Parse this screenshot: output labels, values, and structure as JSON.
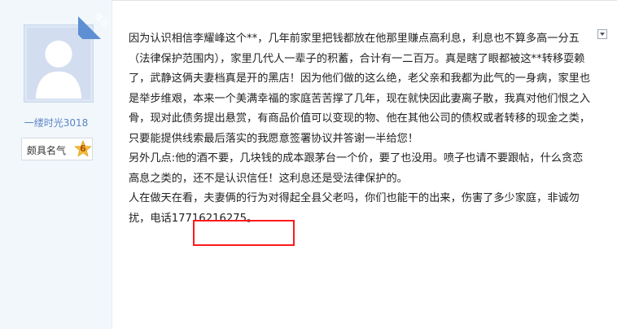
{
  "post": {
    "badge_label": "楼主",
    "author": {
      "username": "一缕时光3018",
      "reputation_label": "颇具名气",
      "reputation_level": "6"
    },
    "paragraphs": [
      "因为认识相信李耀峰这个**，几年前家里把钱都放在他那里赚点高利息，利息也不算多高一分五（法律保护范围内），家里几代人一辈子的积蓄，合计有一二百万。真是瞎了眼都被这**转移耍赖了，武静这俩夫妻档真是开的黑店！因为他们做的这么绝，老父亲和我都为此气的一身病，家里也是举步维艰，本来一个美满幸福的家庭苦苦撑了几年，现在就快因此妻离子散，我真对他们恨之入骨，现对此债务提出悬赏，有商品价值可以变现的物、他在其他公司的债权或者转移的现金之类，只要能提供线索最后落实的我愿意签署协议并答谢一半给您！",
      "另外几点:他的酒不要，几块钱的成本跟茅台一个价，要了也没用。喷子也请不要跟帖，什么贪恋高息之类的，还不是认识信任！这利息还是受法律保护的。",
      "人在做天在看，夫妻俩的行为对得起全县父老吗，你们也能干的出来，伤害了多少家庭，非诚勿扰，电话17716216275。"
    ]
  },
  "icons": {
    "menu": "chevron-down-icon",
    "badge": "star-icon"
  },
  "colors": {
    "sidebar_bg": "#f2f7fb",
    "ribbon": "#5d8fd2",
    "username": "#5b84c6",
    "highlight": "#ff1a1a"
  }
}
